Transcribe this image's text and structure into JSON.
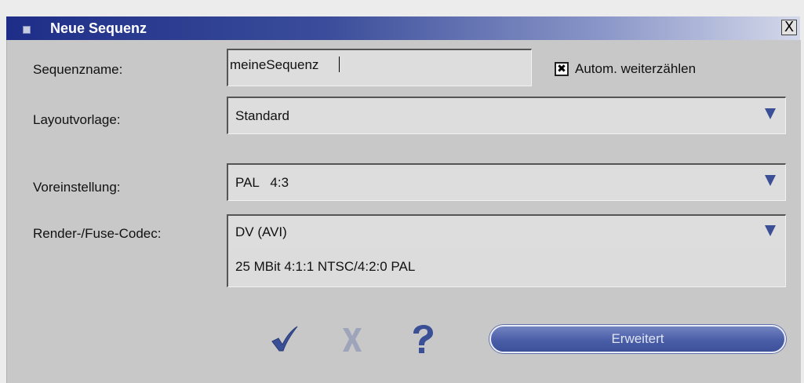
{
  "dialog": {
    "title": "Neue Sequenz",
    "close_label": "X"
  },
  "form": {
    "sequence_name": {
      "label": "Sequenzname:",
      "value": "meineSequenz"
    },
    "auto_increment": {
      "label": "Autom. weiterzählen",
      "checked": true,
      "mark": "✖"
    },
    "layout_template": {
      "label": "Layoutvorlage:",
      "value": "Standard"
    },
    "preset": {
      "label": "Voreinstellung:",
      "value": "PAL   4:3"
    },
    "codec": {
      "label": "Render-/Fuse-Codec:",
      "value": "DV (AVI)",
      "detail": "25 MBit 4:1:1 NTSC/4:2:0 PAL"
    }
  },
  "buttons": {
    "ok_icon": "checkmark-icon",
    "cancel_icon": "x-icon",
    "help_icon": "question-icon",
    "advanced_label": "Erweitert"
  },
  "colors": {
    "accent": "#3a4f96",
    "title_gradient_start": "#1e2e88",
    "panel": "#c8c8c8"
  }
}
